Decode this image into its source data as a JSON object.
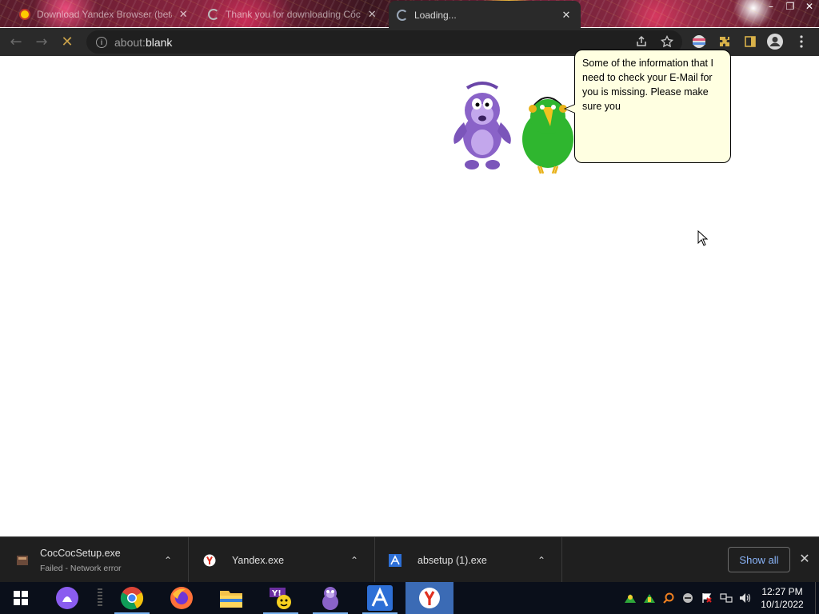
{
  "browser": {
    "tabs": [
      {
        "title": "Download Yandex Browser (beta)",
        "favicon": "yandex-icon",
        "close": "✕"
      },
      {
        "title": "Thank you for downloading Cốc Cốc",
        "favicon": "loading-spinner-icon",
        "close": "✕"
      },
      {
        "title": "Loading...",
        "favicon": "loading-spinner-icon",
        "close": "✕",
        "active": true
      }
    ],
    "window_controls": {
      "minimize": "–",
      "restore": "❐",
      "close": "✕"
    },
    "toolbar": {
      "back": "←",
      "forward": "→",
      "stop": "✕",
      "url_scheme": "about:",
      "url_host": "blank",
      "icons": [
        "share-icon",
        "bookmark-star-icon",
        "extension-icon",
        "puzzle-extensions-icon",
        "side-panel-icon",
        "profile-icon",
        "menu-icon"
      ]
    }
  },
  "content": {
    "bonzi_bubble_text": "Some of the information that I need to check your E-Mail for you is missing. Please make sure you"
  },
  "downloads": {
    "items": [
      {
        "name": "CocCocSetup.exe",
        "status": "Failed - Network error",
        "icon": "coccoc-file-icon"
      },
      {
        "name": "Yandex.exe",
        "status": "",
        "icon": "yandex-file-icon"
      },
      {
        "name": "absetup (1).exe",
        "status": "",
        "icon": "absetup-file-icon"
      }
    ],
    "show_all": "Show all",
    "close": "✕"
  },
  "taskbar": {
    "apps": [
      "windows-start-icon",
      "alice-icon",
      "chrome-icon",
      "firefox-icon",
      "file-explorer-icon",
      "yahoo-messenger-icon",
      "bonzibuddy-icon",
      "absetup-icon",
      "yandex-browser-icon"
    ],
    "clock_time": "12:27 PM",
    "clock_date": "10/1/2022"
  },
  "colors": {
    "toolbar_bg": "#2a2a2a",
    "downloads_bg": "#1f1f1f",
    "bubble_bg": "#ffffe1",
    "show_all_text": "#8ab4f8",
    "taskbar_active": "#3b6bb5"
  }
}
